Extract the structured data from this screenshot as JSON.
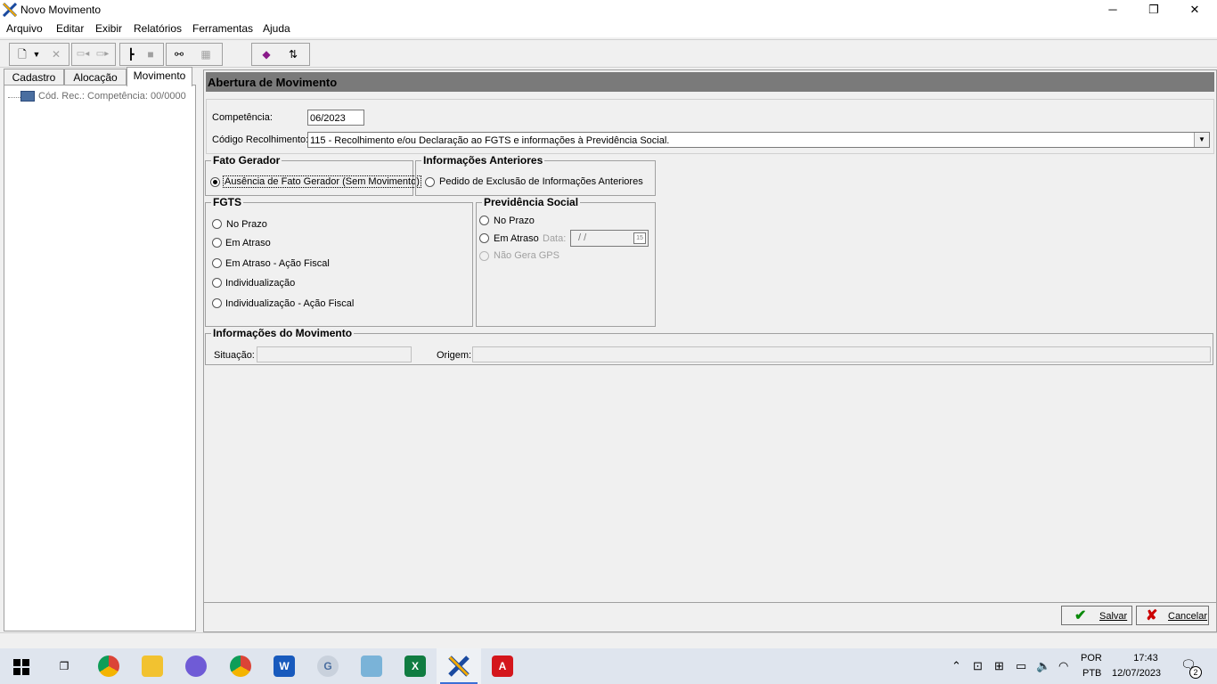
{
  "window": {
    "title": "Novo Movimento",
    "minimize_glyph": "─",
    "maximize_glyph": "❐",
    "close_glyph": "✕"
  },
  "menu": [
    "Arquivo",
    "Editar",
    "Exibir",
    "Relatórios",
    "Ferramentas",
    "Ajuda"
  ],
  "left_tabs": [
    "Cadastro",
    "Alocação",
    "Movimento"
  ],
  "tree": {
    "item_label": "Cód. Rec.: Competência: 00/0000"
  },
  "form": {
    "header": "Abertura de Movimento",
    "competencia_label": "Competência:",
    "competencia_value": "06/2023",
    "codigo_label": "Código Recolhimento:",
    "codigo_value": "115 - Recolhimento e/ou Declaração ao FGTS e informações à Previdência Social."
  },
  "fato_gerador": {
    "title": "Fato Gerador",
    "option": "Ausência de Fato Gerador (Sem Movimento)"
  },
  "info_anteriores": {
    "title": "Informações Anteriores",
    "option": "Pedido de Exclusão de Informações Anteriores"
  },
  "fgts": {
    "title": "FGTS",
    "options": [
      "No Prazo",
      "Em Atraso",
      "Em Atraso - Ação Fiscal",
      "Individualização",
      "Individualização - Ação Fiscal"
    ]
  },
  "previdencia": {
    "title": "Previdência Social",
    "no_prazo": "No Prazo",
    "em_atraso": "Em Atraso",
    "data_label": "Data:",
    "data_value": "/ /",
    "calendar_label": "15",
    "nao_gera": "Não Gera GPS"
  },
  "info_movimento": {
    "title": "Informações do Movimento",
    "situacao_label": "Situação:",
    "situacao_value": "",
    "origem_label": "Origem:",
    "origem_value": ""
  },
  "buttons": {
    "save": "Salvar",
    "cancel": "Cancelar"
  },
  "taskbar": {
    "lang_top": "POR",
    "lang_bottom": "PTB",
    "time": "17:43",
    "date": "12/07/2023",
    "notification_count": "2"
  },
  "colors": {
    "header_bg": "#7a7a7a",
    "save_icon": "#0a8a0a",
    "cancel_icon": "#cc0000"
  }
}
